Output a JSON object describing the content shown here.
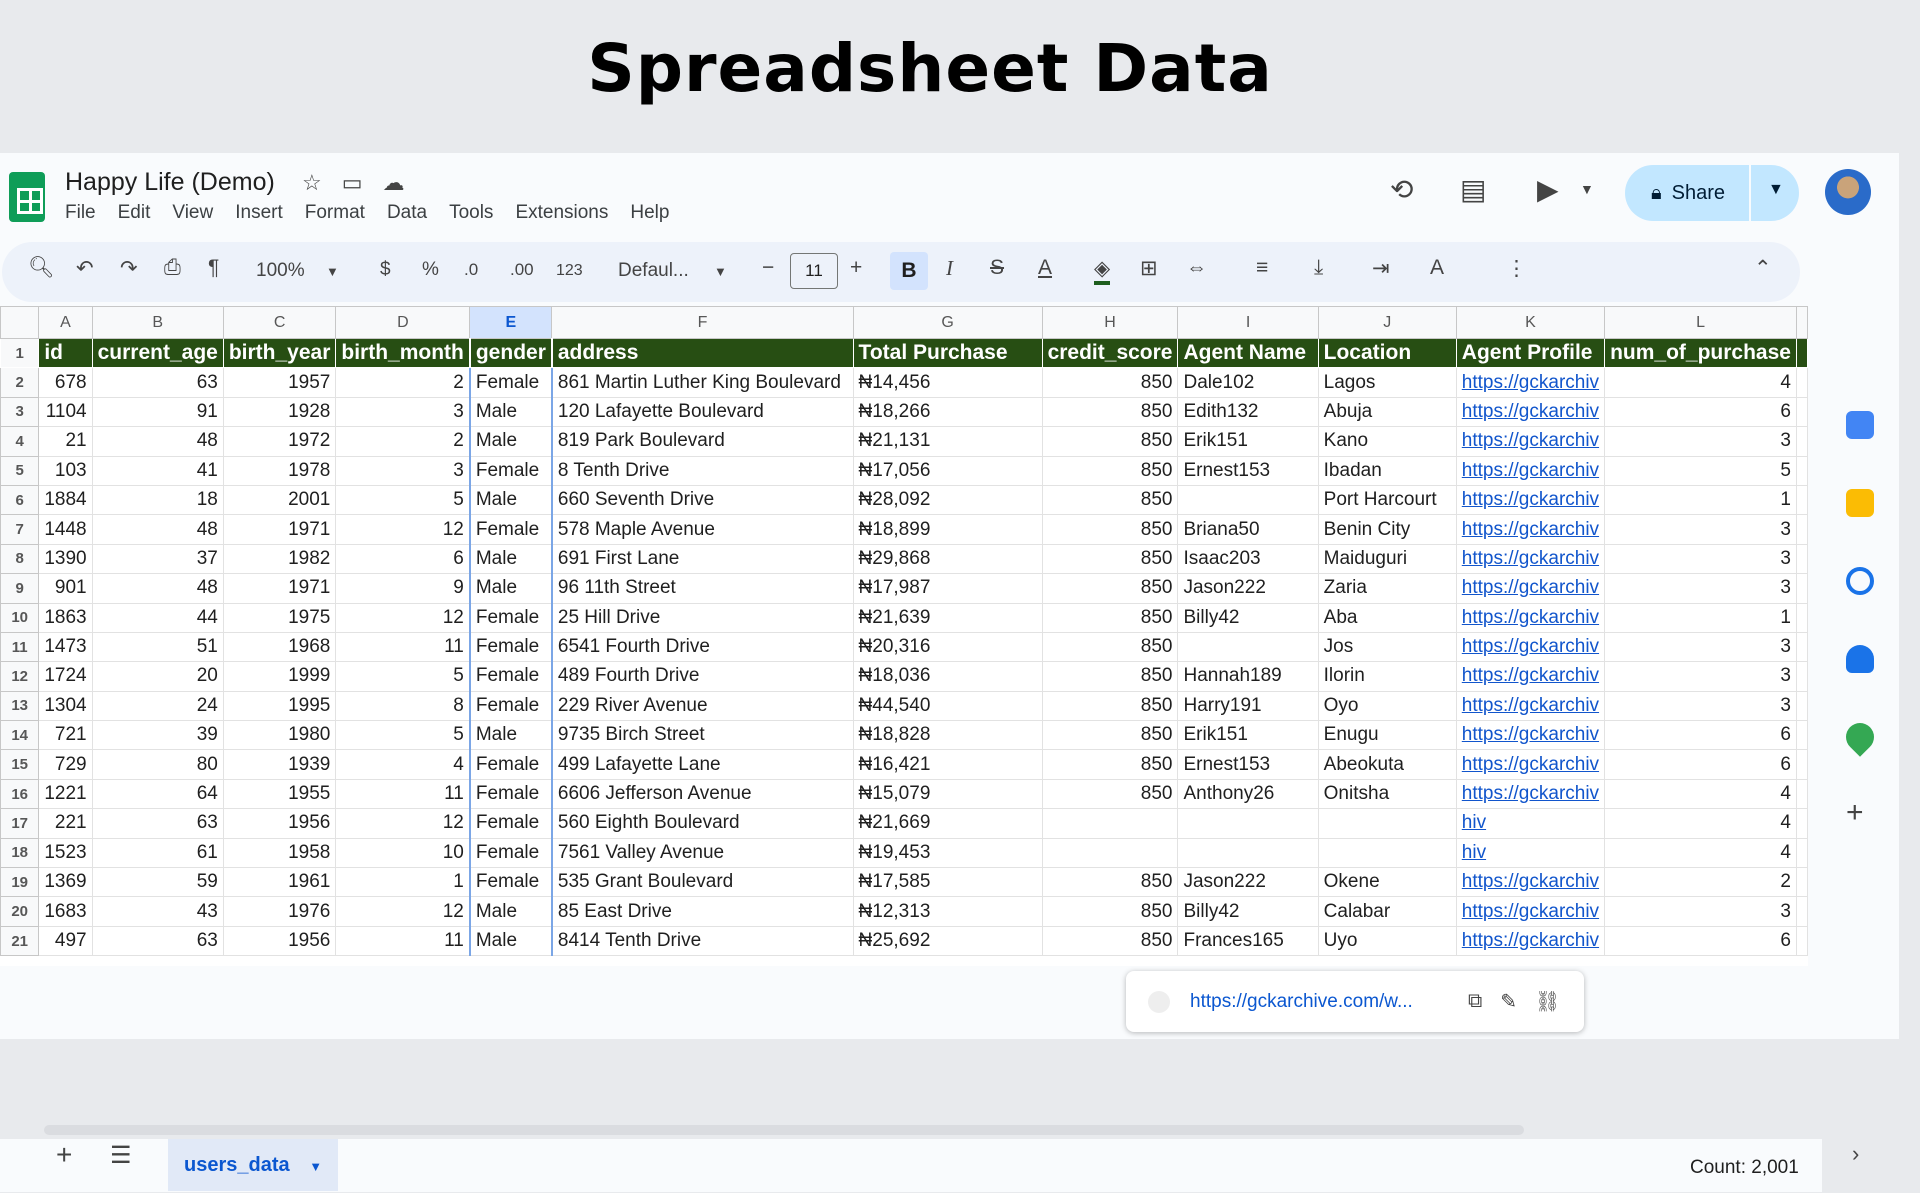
{
  "page_title": "Spreadsheet Data",
  "doc": {
    "title": "Happy Life (Demo)"
  },
  "menu": [
    "File",
    "Edit",
    "View",
    "Insert",
    "Format",
    "Data",
    "Tools",
    "Extensions",
    "Help"
  ],
  "share": {
    "label": "Share"
  },
  "toolbar": {
    "zoom": "100%",
    "currency": "$",
    "percent": "%",
    "dec_decrease": ".0",
    "dec_increase": ".00",
    "format_123": "123",
    "font": "Defaul...",
    "font_size": "11"
  },
  "columns": [
    "A",
    "B",
    "C",
    "D",
    "E",
    "F",
    "G",
    "H",
    "I",
    "J",
    "K",
    "L"
  ],
  "selected_column": "E",
  "headers": [
    "id",
    "current_age",
    "birth_year",
    "birth_month",
    "gender",
    "address",
    "Total Purchase",
    "credit_score",
    "Agent Name",
    "Location",
    "Agent Profile",
    "num_of_purchase"
  ],
  "rows": [
    {
      "n": "2",
      "id": "678",
      "age": "63",
      "year": "1957",
      "month": "2",
      "gender": "Female",
      "address": "861 Martin Luther King Boulevard",
      "total": "₦14,456",
      "credit": "850",
      "agent": "Dale102",
      "location": "Lagos",
      "profile": "https://gckarchiv",
      "purchases": "4"
    },
    {
      "n": "3",
      "id": "1104",
      "age": "91",
      "year": "1928",
      "month": "3",
      "gender": "Male",
      "address": "120 Lafayette Boulevard",
      "total": "₦18,266",
      "credit": "850",
      "agent": "Edith132",
      "location": "Abuja",
      "profile": "https://gckarchiv",
      "purchases": "6"
    },
    {
      "n": "4",
      "id": "21",
      "age": "48",
      "year": "1972",
      "month": "2",
      "gender": "Male",
      "address": "819 Park Boulevard",
      "total": "₦21,131",
      "credit": "850",
      "agent": "Erik151",
      "location": "Kano",
      "profile": "https://gckarchiv",
      "purchases": "3"
    },
    {
      "n": "5",
      "id": "103",
      "age": "41",
      "year": "1978",
      "month": "3",
      "gender": "Female",
      "address": "8 Tenth Drive",
      "total": "₦17,056",
      "credit": "850",
      "agent": "Ernest153",
      "location": "Ibadan",
      "profile": "https://gckarchiv",
      "purchases": "5"
    },
    {
      "n": "6",
      "id": "1884",
      "age": "18",
      "year": "2001",
      "month": "5",
      "gender": "Male",
      "address": "660 Seventh Drive",
      "total": "₦28,092",
      "credit": "850",
      "agent": "",
      "location": "Port Harcourt",
      "profile": "https://gckarchiv",
      "purchases": "1"
    },
    {
      "n": "7",
      "id": "1448",
      "age": "48",
      "year": "1971",
      "month": "12",
      "gender": "Female",
      "address": "578 Maple Avenue",
      "total": "₦18,899",
      "credit": "850",
      "agent": "Briana50",
      "location": "Benin City",
      "profile": "https://gckarchiv",
      "purchases": "3"
    },
    {
      "n": "8",
      "id": "1390",
      "age": "37",
      "year": "1982",
      "month": "6",
      "gender": "Male",
      "address": "691 First Lane",
      "total": "₦29,868",
      "credit": "850",
      "agent": "Isaac203",
      "location": "Maiduguri",
      "profile": "https://gckarchiv",
      "purchases": "3"
    },
    {
      "n": "9",
      "id": "901",
      "age": "48",
      "year": "1971",
      "month": "9",
      "gender": "Male",
      "address": "96 11th Street",
      "total": "₦17,987",
      "credit": "850",
      "agent": "Jason222",
      "location": "Zaria",
      "profile": "https://gckarchiv",
      "purchases": "3"
    },
    {
      "n": "10",
      "id": "1863",
      "age": "44",
      "year": "1975",
      "month": "12",
      "gender": "Female",
      "address": "25 Hill Drive",
      "total": "₦21,639",
      "credit": "850",
      "agent": "Billy42",
      "location": "Aba",
      "profile": "https://gckarchiv",
      "purchases": "1"
    },
    {
      "n": "11",
      "id": "1473",
      "age": "51",
      "year": "1968",
      "month": "11",
      "gender": "Female",
      "address": "6541 Fourth Drive",
      "total": "₦20,316",
      "credit": "850",
      "agent": "",
      "location": "Jos",
      "profile": "https://gckarchiv",
      "purchases": "3"
    },
    {
      "n": "12",
      "id": "1724",
      "age": "20",
      "year": "1999",
      "month": "5",
      "gender": "Female",
      "address": "489 Fourth Drive",
      "total": "₦18,036",
      "credit": "850",
      "agent": "Hannah189",
      "location": "Ilorin",
      "profile": "https://gckarchiv",
      "purchases": "3"
    },
    {
      "n": "13",
      "id": "1304",
      "age": "24",
      "year": "1995",
      "month": "8",
      "gender": "Female",
      "address": "229 River Avenue",
      "total": "₦44,540",
      "credit": "850",
      "agent": "Harry191",
      "location": "Oyo",
      "profile": "https://gckarchiv",
      "purchases": "3"
    },
    {
      "n": "14",
      "id": "721",
      "age": "39",
      "year": "1980",
      "month": "5",
      "gender": "Male",
      "address": "9735 Birch Street",
      "total": "₦18,828",
      "credit": "850",
      "agent": "Erik151",
      "location": "Enugu",
      "profile": "https://gckarchiv",
      "purchases": "6"
    },
    {
      "n": "15",
      "id": "729",
      "age": "80",
      "year": "1939",
      "month": "4",
      "gender": "Female",
      "address": "499 Lafayette Lane",
      "total": "₦16,421",
      "credit": "850",
      "agent": "Ernest153",
      "location": "Abeokuta",
      "profile": "https://gckarchiv",
      "purchases": "6"
    },
    {
      "n": "16",
      "id": "1221",
      "age": "64",
      "year": "1955",
      "month": "11",
      "gender": "Female",
      "address": "6606 Jefferson Avenue",
      "total": "₦15,079",
      "credit": "850",
      "agent": "Anthony26",
      "location": "Onitsha",
      "profile": "https://gckarchiv",
      "purchases": "4"
    },
    {
      "n": "17",
      "id": "221",
      "age": "63",
      "year": "1956",
      "month": "12",
      "gender": "Female",
      "address": "560 Eighth Boulevard",
      "total": "₦21,669",
      "credit": "",
      "agent": "",
      "location": "",
      "profile": "hiv",
      "purchases": "4"
    },
    {
      "n": "18",
      "id": "1523",
      "age": "61",
      "year": "1958",
      "month": "10",
      "gender": "Female",
      "address": "7561 Valley Avenue",
      "total": "₦19,453",
      "credit": "",
      "agent": "",
      "location": "",
      "profile": "hiv",
      "purchases": "4"
    },
    {
      "n": "19",
      "id": "1369",
      "age": "59",
      "year": "1961",
      "month": "1",
      "gender": "Female",
      "address": "535 Grant Boulevard",
      "total": "₦17,585",
      "credit": "850",
      "agent": "Jason222",
      "location": "Okene",
      "profile": "https://gckarchiv",
      "purchases": "2"
    },
    {
      "n": "20",
      "id": "1683",
      "age": "43",
      "year": "1976",
      "month": "12",
      "gender": "Male",
      "address": "85 East Drive",
      "total": "₦12,313",
      "credit": "850",
      "agent": "Billy42",
      "location": "Calabar",
      "profile": "https://gckarchiv",
      "purchases": "3"
    },
    {
      "n": "21",
      "id": "497",
      "age": "63",
      "year": "1956",
      "month": "11",
      "gender": "Male",
      "address": "8414 Tenth Drive",
      "total": "₦25,692",
      "credit": "850",
      "agent": "Frances165",
      "location": "Uyo",
      "profile": "https://gckarchiv",
      "purchases": "6"
    }
  ],
  "link_popup": {
    "url": "https://gckarchive.com/w..."
  },
  "sheet_tab": {
    "label": "users_data"
  },
  "status": {
    "count": "Count: 2,001"
  }
}
